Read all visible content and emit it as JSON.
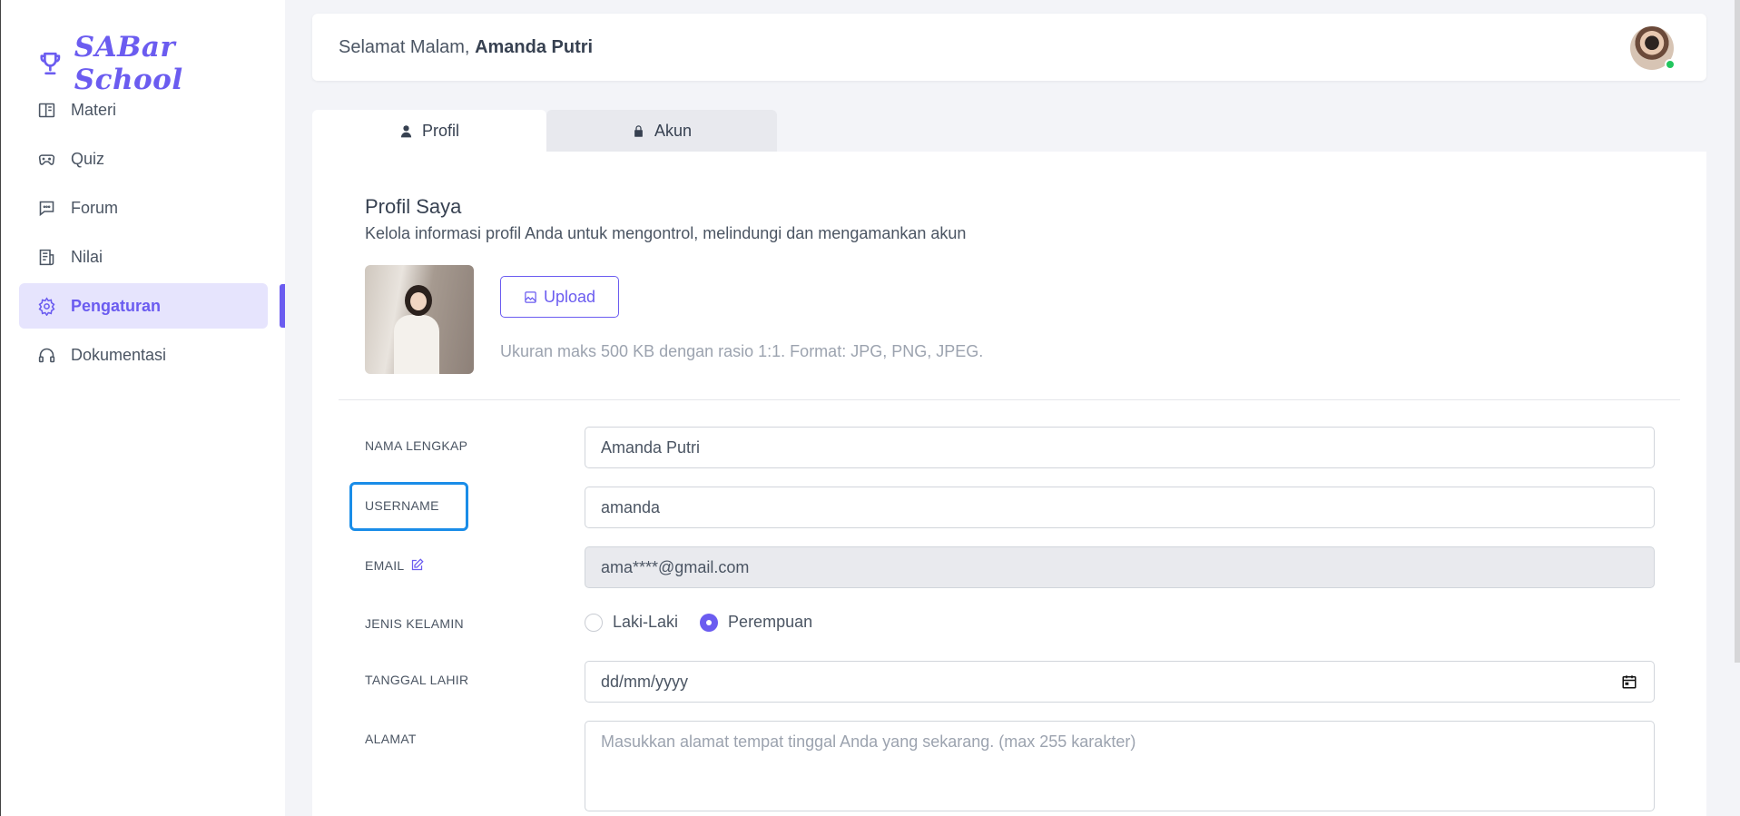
{
  "brand": {
    "name": "SABar School",
    "icon": "trophy-icon"
  },
  "sidebar": {
    "items": [
      {
        "label": "Materi",
        "icon": "book-open-icon"
      },
      {
        "label": "Quiz",
        "icon": "gamepad-icon"
      },
      {
        "label": "Forum",
        "icon": "chat-icon"
      },
      {
        "label": "Nilai",
        "icon": "report-icon"
      },
      {
        "label": "Pengaturan",
        "icon": "gear-icon",
        "active": true
      },
      {
        "label": "Dokumentasi",
        "icon": "headset-icon"
      }
    ]
  },
  "header": {
    "greeting": "Selamat Malam,",
    "user_name": "Amanda Putri",
    "online_color": "#22c55e"
  },
  "tabs": [
    {
      "label": "Profil",
      "icon": "user-icon",
      "active": true
    },
    {
      "label": "Akun",
      "icon": "lock-icon"
    }
  ],
  "profile": {
    "title": "Profil Saya",
    "subtitle": "Kelola informasi profil Anda untuk mengontrol, melindungi dan mengamankan akun",
    "upload_label": "Upload",
    "upload_note": "Ukuran maks 500 KB dengan rasio 1:1. Format: JPG, PNG, JPEG."
  },
  "form": {
    "name_label": "NAMA LENGKAP",
    "name_value": "Amanda Putri",
    "username_label": "USERNAME",
    "username_value": "amanda",
    "email_label": "EMAIL",
    "email_value": "ama****@gmail.com",
    "gender_label": "JENIS KELAMIN",
    "gender_options": [
      "Laki-Laki",
      "Perempuan"
    ],
    "gender_selected": "Perempuan",
    "dob_label": "TANGGAL LAHIR",
    "dob_placeholder": "dd/mm/yyyy",
    "address_label": "ALAMAT",
    "address_placeholder": "Masukkan alamat tempat tinggal Anda yang sekarang. (max 255 karakter)"
  },
  "colors": {
    "accent": "#6b5cf0",
    "focus_ring": "#1a8de8"
  }
}
